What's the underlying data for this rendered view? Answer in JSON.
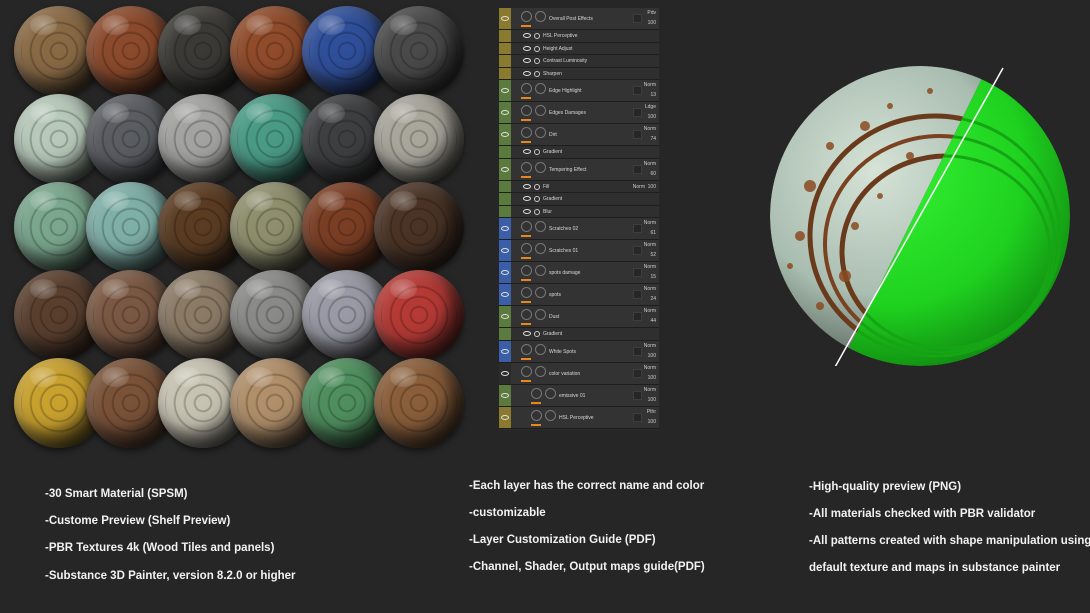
{
  "materials_preview": {
    "rows": [
      [
        "#8a6a45",
        "#8b4a2c",
        "#3b3a36",
        "#8f4b2a",
        "#2f4f9a",
        "#4a4a4a"
      ],
      [
        "#b7c9b9",
        "#5a5d62",
        "#a3a3a1",
        "#4a9b86",
        "#3e3f41",
        "#a9a79c"
      ],
      [
        "#7aa78d",
        "#7fb0a8",
        "#5a3c22",
        "#8f8f6e",
        "#7a3e24",
        "#4b3426"
      ],
      [
        "#5a3f2e",
        "#7a5843",
        "#8b7a66",
        "#8a8a88",
        "#9a9aa6",
        "#b53a35"
      ],
      [
        "#c9a12e",
        "#7a5238",
        "#c7c3b2",
        "#b08f6a",
        "#4f8f5e",
        "#8a5e3a"
      ]
    ]
  },
  "layers_panel": {
    "layers": [
      {
        "name": "Overall Post Effects",
        "blend": "Pdv",
        "opacity": "100",
        "color": "#8a7a2e",
        "kind": "folder"
      },
      {
        "name": "HSL Perceptive",
        "color": "#8a7a2e",
        "kind": "effect"
      },
      {
        "name": "Height Adjust",
        "color": "#8a7a2e",
        "kind": "effect"
      },
      {
        "name": "Contrast Luminosity",
        "color": "#8a7a2e",
        "kind": "effect"
      },
      {
        "name": "Sharpen",
        "color": "#8a7a2e",
        "kind": "effect"
      },
      {
        "name": "Edge Highlight",
        "blend": "Norm",
        "opacity": "13",
        "color": "#5a7a3e",
        "kind": "layer"
      },
      {
        "name": "Edges Damages",
        "blend": "Ldge",
        "opacity": "100",
        "color": "#5a7a3e",
        "kind": "layer"
      },
      {
        "name": "Dirt",
        "blend": "Norm",
        "opacity": "74",
        "color": "#5a7a3e",
        "kind": "layer"
      },
      {
        "name": "Gradient",
        "color": "#5a7a3e",
        "kind": "effect"
      },
      {
        "name": "Tempering Effect",
        "blend": "Norm",
        "opacity": "60",
        "color": "#5a7a3e",
        "kind": "layer"
      },
      {
        "name": "Fill",
        "blend": "Norm",
        "opacity": "100",
        "color": "#5a7a3e",
        "kind": "fill"
      },
      {
        "name": "Gradient",
        "color": "#5a7a3e",
        "kind": "effect"
      },
      {
        "name": "Blur",
        "color": "#5a7a3e",
        "kind": "effect"
      },
      {
        "name": "Scratches 02",
        "blend": "Norm",
        "opacity": "61",
        "color": "#3a5fa8",
        "kind": "layer"
      },
      {
        "name": "Scratches 01",
        "blend": "Norm",
        "opacity": "52",
        "color": "#3a5fa8",
        "kind": "layer"
      },
      {
        "name": "spots damage",
        "blend": "Norm",
        "opacity": "15",
        "color": "#3a5fa8",
        "kind": "layer"
      },
      {
        "name": "spots",
        "blend": "Norm",
        "opacity": "24",
        "color": "#3a5fa8",
        "kind": "layer"
      },
      {
        "name": "Dust",
        "blend": "Norm",
        "opacity": "44",
        "color": "#5a7a3e",
        "kind": "layer"
      },
      {
        "name": "Gradient",
        "color": "#5a7a3e",
        "kind": "effect"
      },
      {
        "name": "White Spots",
        "blend": "Norm",
        "opacity": "100",
        "color": "#3a5fa8",
        "kind": "layer"
      },
      {
        "name": "color variation",
        "blend": "Norm",
        "opacity": "100",
        "color": "#2b2b2b",
        "kind": "folder2"
      },
      {
        "name": "emissive 01",
        "blend": "Norm",
        "opacity": "100",
        "color": "#5a7a3e",
        "kind": "layer-indent"
      },
      {
        "name": "HSL Perceptive",
        "blend": "Pthr",
        "opacity": "100",
        "color": "#8a7a2e",
        "kind": "layer-indent"
      }
    ]
  },
  "features": {
    "col1": [
      "-30 Smart Material  (SPSM)",
      "-Custome Preview (Shelf Preview)",
      "-PBR Textures 4k (Wood Tiles and panels)",
      "-Substance 3D Painter, version 8.2.0 or higher"
    ],
    "col2": [
      "-Each layer has the correct name and color",
      "-customizable",
      "-Layer Customization Guide (PDF)",
      "-Channel, Shader, Output maps guide(PDF)"
    ],
    "col3": [
      "-High-quality preview (PNG)",
      "-All materials checked with PBR validator",
      "-All patterns created with shape manipulation using",
      "default texture and maps in substance painter"
    ]
  },
  "colors": {
    "background": "#262626",
    "id_green": "#1fd11f",
    "rust_base": "#b9cbbf",
    "accent_orange": "#e8871c"
  }
}
